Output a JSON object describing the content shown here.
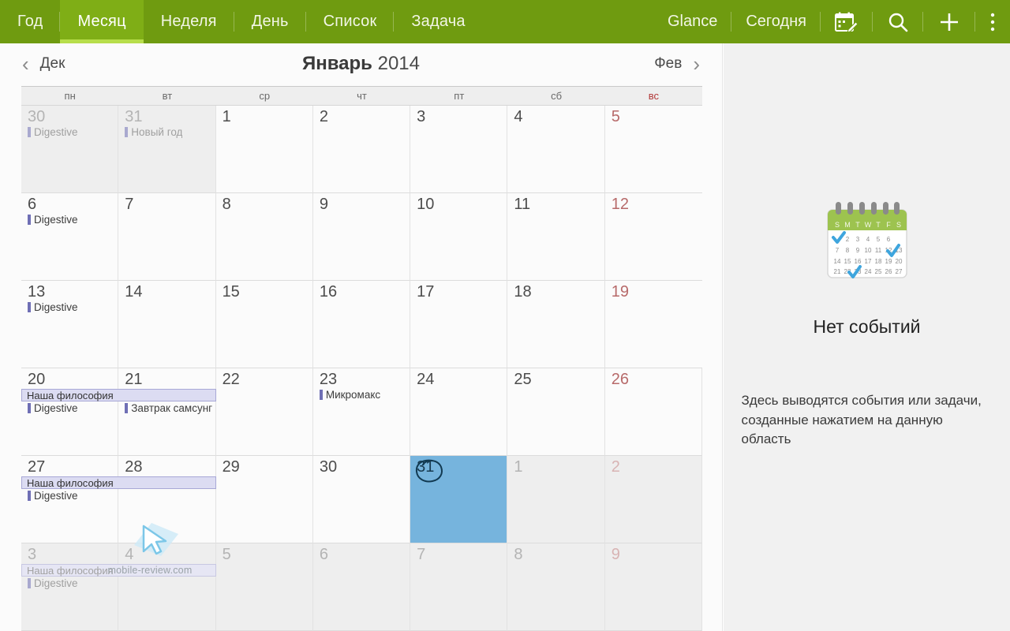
{
  "topbar": {
    "tabs": [
      {
        "label": "Год",
        "active": false
      },
      {
        "label": "Месяц",
        "active": true
      },
      {
        "label": "Неделя",
        "active": false
      },
      {
        "label": "День",
        "active": false
      },
      {
        "label": "Список",
        "active": false
      },
      {
        "label": "Задача",
        "active": false
      }
    ],
    "actions": [
      {
        "label": "Glance",
        "icon": ""
      },
      {
        "label": "Сегодня",
        "icon": ""
      },
      {
        "label": "",
        "icon": "calendar-edit-icon"
      },
      {
        "label": "",
        "icon": "search-icon"
      },
      {
        "label": "",
        "icon": "add-icon"
      },
      {
        "label": "",
        "icon": "more-options-icon"
      }
    ],
    "background_color": "#6f9b10",
    "active_tab_color": "#7fae16",
    "active_underline_color": "#b7de4b"
  },
  "calendar": {
    "prev_label": "Дек",
    "next_label": "Фев",
    "month_name": "Январь",
    "year": "2014",
    "weekdays": [
      "пн",
      "вт",
      "ср",
      "чт",
      "пт",
      "сб",
      "вс"
    ],
    "sunday_color": "#b23838",
    "selected_color": "#76b4dd",
    "event_marker_color": "#6f6fb5",
    "weeks": [
      [
        {
          "day": "30",
          "other": true,
          "events": [
            "Digestive"
          ]
        },
        {
          "day": "31",
          "other": true,
          "events": [
            "Новый год"
          ]
        },
        {
          "day": "1",
          "other": false,
          "events": []
        },
        {
          "day": "2",
          "other": false,
          "events": []
        },
        {
          "day": "3",
          "other": false,
          "events": []
        },
        {
          "day": "4",
          "other": false,
          "events": []
        },
        {
          "day": "5",
          "other": false,
          "events": [],
          "sunday": true
        }
      ],
      [
        {
          "day": "6",
          "other": false,
          "events": [
            "Digestive"
          ]
        },
        {
          "day": "7",
          "other": false,
          "events": []
        },
        {
          "day": "8",
          "other": false,
          "events": []
        },
        {
          "day": "9",
          "other": false,
          "events": []
        },
        {
          "day": "10",
          "other": false,
          "events": []
        },
        {
          "day": "11",
          "other": false,
          "events": []
        },
        {
          "day": "12",
          "other": false,
          "events": [],
          "sunday": true
        }
      ],
      [
        {
          "day": "13",
          "other": false,
          "events": [
            "Digestive"
          ]
        },
        {
          "day": "14",
          "other": false,
          "events": []
        },
        {
          "day": "15",
          "other": false,
          "events": []
        },
        {
          "day": "16",
          "other": false,
          "events": []
        },
        {
          "day": "17",
          "other": false,
          "events": []
        },
        {
          "day": "18",
          "other": false,
          "events": []
        },
        {
          "day": "19",
          "other": false,
          "events": [],
          "sunday": true
        }
      ],
      [
        {
          "day": "20",
          "other": false,
          "events": [
            "Digestive"
          ]
        },
        {
          "day": "21",
          "other": false,
          "events": [
            "Завтрак самсунг"
          ]
        },
        {
          "day": "22",
          "other": false,
          "events": []
        },
        {
          "day": "23",
          "other": false,
          "events": [
            "Микромакс"
          ]
        },
        {
          "day": "24",
          "other": false,
          "events": []
        },
        {
          "day": "25",
          "other": false,
          "events": []
        },
        {
          "day": "26",
          "other": false,
          "events": [],
          "sunday": true
        }
      ],
      [
        {
          "day": "27",
          "other": false,
          "events": [
            "Digestive"
          ]
        },
        {
          "day": "28",
          "other": false,
          "events": []
        },
        {
          "day": "29",
          "other": false,
          "events": []
        },
        {
          "day": "30",
          "other": false,
          "events": []
        },
        {
          "day": "31",
          "other": false,
          "events": [],
          "selected": true
        },
        {
          "day": "1",
          "other": true,
          "events": []
        },
        {
          "day": "2",
          "other": true,
          "events": [],
          "sunday": true
        }
      ],
      [
        {
          "day": "3",
          "other": true,
          "events": [
            "Digestive"
          ]
        },
        {
          "day": "4",
          "other": true,
          "events": []
        },
        {
          "day": "5",
          "other": true,
          "events": []
        },
        {
          "day": "6",
          "other": true,
          "events": []
        },
        {
          "day": "7",
          "other": true,
          "events": []
        },
        {
          "day": "8",
          "other": true,
          "events": []
        },
        {
          "day": "9",
          "other": true,
          "events": [],
          "sunday": true
        }
      ]
    ],
    "spans": [
      {
        "label": "Наша философия",
        "week": 3,
        "start_col": 0,
        "end_col": 1,
        "faded": false
      },
      {
        "label": "Наша философия",
        "week": 4,
        "start_col": 0,
        "end_col": 1,
        "faded": false
      },
      {
        "label": "Наша философия",
        "week": 5,
        "start_col": 0,
        "end_col": 1,
        "faded": true
      }
    ],
    "annotation": {
      "target_day": "31",
      "shape": "hand-drawn-circle"
    }
  },
  "watermark": {
    "text": "mobile-review.com"
  },
  "panel": {
    "empty_title": "Нет событий",
    "empty_description": "Здесь выводятся события или задачи, созданные нажатием на данную область",
    "illustration": {
      "name": "calendar-empty-icon",
      "header_letters": [
        "S",
        "M",
        "T",
        "W",
        "T",
        "F",
        "S"
      ],
      "rows": [
        [
          "",
          "2",
          "3",
          "4",
          "5",
          "6"
        ],
        [
          "7",
          "8",
          "9",
          "10",
          "11",
          "12",
          "13"
        ],
        [
          "14",
          "15",
          "16",
          "17",
          "18",
          "19",
          "20"
        ],
        [
          "21",
          "22",
          "23",
          "24",
          "25",
          "26",
          "27"
        ]
      ],
      "header_color": "#9dc34f"
    }
  }
}
